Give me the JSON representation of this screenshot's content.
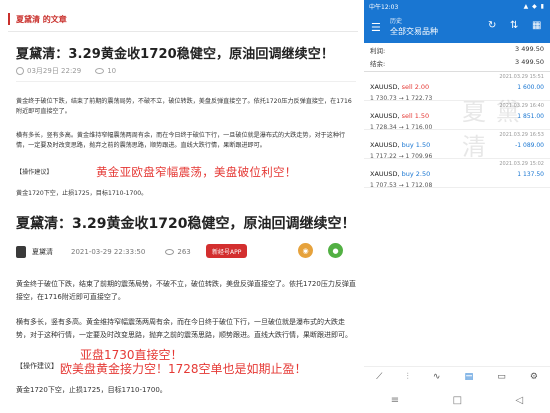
{
  "article_list": {
    "header": "夏黛清 的文章"
  },
  "article1": {
    "title": "夏黛清：3.29黄金收1720稳健空，原油回调继续空！",
    "date": "03月29日 22:29",
    "views": "10",
    "para1": "黄金终于破位下跌，结束了前期的震荡局势，不破不立，破位转跌，美盘反弹直接空了。依托1720压力反弹直接空，在1716附近即可直接空了。",
    "para2": "横有多长，竖有多高。黄金维持窄幅震荡两周有余，而在今日终于破位下行，一旦破位就是瀑布式的大跌走势，对于这种行情，一定要及时改变思路，抛弃之前的震荡思路，顺势跟进。直线大跌行情，果断跟进即可。",
    "advice_label": "【操作建议】",
    "advice_text": "黄金1720下空，止损1725，目标1710-1700。",
    "overlay": "黄金亚欧盘窄幅震荡，美盘破位利空！"
  },
  "article2": {
    "title": "夏黛清：3.29黄金收1720稳健空，原油回调继续空！",
    "author": "夏黛清",
    "date": "2021-03-29 22:33:50",
    "views": "263",
    "app_button": "新经号APP",
    "para1": "黄金终于破位下跌，结束了前期的震荡局势，不破不立，破位转跌，美盘反弹直接空了。依托1720压力反弹直接空，在1716附近即可直接空了。",
    "para2": "横有多长，竖有多高。黄金维持窄幅震荡两周有余，而在今日终于破位下行，一旦破位就是瀑布式的大跌走势，对于这种行情，一定要及时改变思路，抛弃之前的震荡思路，顺势跟进。直线大跌行情，果断跟进即可。",
    "advice_label": "【操作建议】",
    "advice_text": "黄金1720下空，止损1725，目标1710-1700。",
    "overlay1": "亚盘1730直接空！",
    "overlay2": "欧美盘黄金接力空！1728空单也是如期止盈！"
  },
  "trading_app": {
    "status_time": "中午12:03",
    "status_icons": "▲ ◆ ▮",
    "history_label": "历史",
    "title": "全部交易品种",
    "balance_label": "利润:",
    "balance_value": "3 499.50",
    "equity_label": "结余:",
    "equity_value": "3 499.50",
    "watermark": "夏黛清",
    "positions": [
      {
        "symbol": "XAUUSD,",
        "side": "sell 2.00",
        "side_type": "sell",
        "time": "2021.03.29 15:51",
        "prices": "1 730.73 → 1 722.73",
        "profit": "1 600.00"
      },
      {
        "symbol": "XAUUSD,",
        "side": "sell 1.50",
        "side_type": "sell",
        "time": "2021.03.29 16:40",
        "prices": "1 728.34 → 1 716.00",
        "profit": "1 851.00"
      },
      {
        "symbol": "XAUUSD,",
        "side": "buy 1.50",
        "side_type": "buy",
        "time": "2021.03.29 16:53",
        "prices": "1 717.22 → 1 709.96",
        "profit": "-1 089.00"
      },
      {
        "symbol": "XAUUSD,",
        "side": "buy 2.50",
        "side_type": "buy",
        "time": "2021.03.29 15:02",
        "prices": "1 707.53 → 1 712.08",
        "profit": "1 137.50"
      }
    ],
    "nav_icons": [
      "chart-line",
      "candles",
      "trend",
      "inbox",
      "news",
      "settings"
    ]
  }
}
